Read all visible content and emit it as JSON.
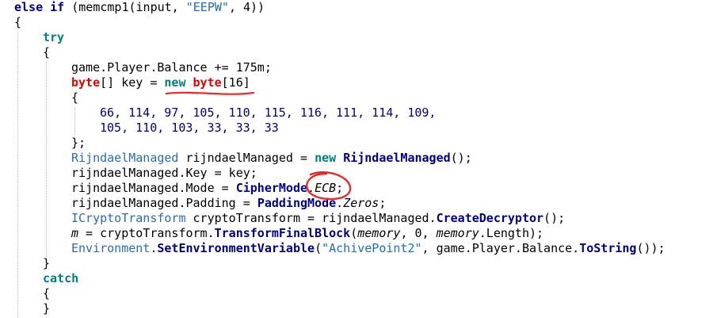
{
  "code_lines": [
    {
      "indent": 0,
      "tokens": [
        {
          "t": "else if",
          "c": "kw-b"
        },
        {
          "t": " (memcmp1(input, "
        },
        {
          "t": "\"EEPW\"",
          "c": "str"
        },
        {
          "t": ", 4))"
        }
      ]
    },
    {
      "indent": 0,
      "tokens": [
        {
          "t": "{"
        }
      ]
    },
    {
      "indent": 1,
      "tokens": [
        {
          "t": "try",
          "c": "kw-g"
        }
      ]
    },
    {
      "indent": 1,
      "tokens": [
        {
          "t": "{"
        }
      ]
    },
    {
      "indent": 2,
      "tokens": [
        {
          "t": "game.Player.Balance += 175m;"
        }
      ]
    },
    {
      "indent": 2,
      "tokens": [
        {
          "t": "byte",
          "c": "kw-r"
        },
        {
          "t": "[] key = "
        },
        {
          "t": "new",
          "c": "kw-g"
        },
        {
          "t": " "
        },
        {
          "t": "byte",
          "c": "kw-r"
        },
        {
          "t": "[16]"
        }
      ]
    },
    {
      "indent": 2,
      "tokens": [
        {
          "t": "{"
        }
      ]
    },
    {
      "indent": 3,
      "tokens": [
        {
          "t": "66, 114, 97, 105, 110, 115, 116, 111, 114, 109,",
          "c": "num"
        }
      ]
    },
    {
      "indent": 3,
      "tokens": [
        {
          "t": "105, 110, 103, 33, 33, 33",
          "c": "num"
        }
      ]
    },
    {
      "indent": 2,
      "tokens": [
        {
          "t": "};"
        }
      ]
    },
    {
      "indent": 2,
      "tokens": [
        {
          "t": "RijndaelManaged",
          "c": "type"
        },
        {
          "t": " rijndaelManaged = "
        },
        {
          "t": "new",
          "c": "kw-g"
        },
        {
          "t": " "
        },
        {
          "t": "RijndaelManaged",
          "c": "type-b"
        },
        {
          "t": "();"
        }
      ]
    },
    {
      "indent": 2,
      "tokens": [
        {
          "t": "rijndaelManaged.Key = key;"
        }
      ]
    },
    {
      "indent": 2,
      "tokens": [
        {
          "t": "rijndaelManaged.Mode = "
        },
        {
          "t": "CipherMode",
          "c": "type-b"
        },
        {
          "t": "."
        },
        {
          "t": "ECB",
          "c": "it"
        },
        {
          "t": ";"
        }
      ]
    },
    {
      "indent": 2,
      "tokens": [
        {
          "t": "rijndaelManaged.Padding = "
        },
        {
          "t": "PaddingMode",
          "c": "type-b"
        },
        {
          "t": "."
        },
        {
          "t": "Zeros",
          "c": "it"
        },
        {
          "t": ";"
        }
      ]
    },
    {
      "indent": 2,
      "tokens": [
        {
          "t": "ICryptoTransform",
          "c": "type"
        },
        {
          "t": " cryptoTransform = rijndaelManaged."
        },
        {
          "t": "CreateDecryptor",
          "c": "meth"
        },
        {
          "t": "();"
        }
      ]
    },
    {
      "indent": 2,
      "tokens": [
        {
          "t": "m",
          "c": "it"
        },
        {
          "t": " = cryptoTransform."
        },
        {
          "t": "TransformFinalBlock",
          "c": "meth"
        },
        {
          "t": "("
        },
        {
          "t": "memory",
          "c": "it"
        },
        {
          "t": ", 0, "
        },
        {
          "t": "memory",
          "c": "it"
        },
        {
          "t": ".Length);"
        }
      ]
    },
    {
      "indent": 2,
      "tokens": [
        {
          "t": "Environment",
          "c": "type"
        },
        {
          "t": "."
        },
        {
          "t": "SetEnvironmentVariable",
          "c": "meth"
        },
        {
          "t": "("
        },
        {
          "t": "\"AchivePoint2\"",
          "c": "str"
        },
        {
          "t": ", game.Player.Balance."
        },
        {
          "t": "ToString",
          "c": "meth"
        },
        {
          "t": "());"
        }
      ]
    },
    {
      "indent": 1,
      "tokens": [
        {
          "t": "}"
        }
      ]
    },
    {
      "indent": 1,
      "tokens": [
        {
          "t": "catch",
          "c": "kw-g"
        }
      ]
    },
    {
      "indent": 1,
      "tokens": [
        {
          "t": "{"
        }
      ]
    },
    {
      "indent": 1,
      "tokens": [
        {
          "t": "}"
        }
      ]
    }
  ],
  "annotations": {
    "color": "#e8282b"
  }
}
